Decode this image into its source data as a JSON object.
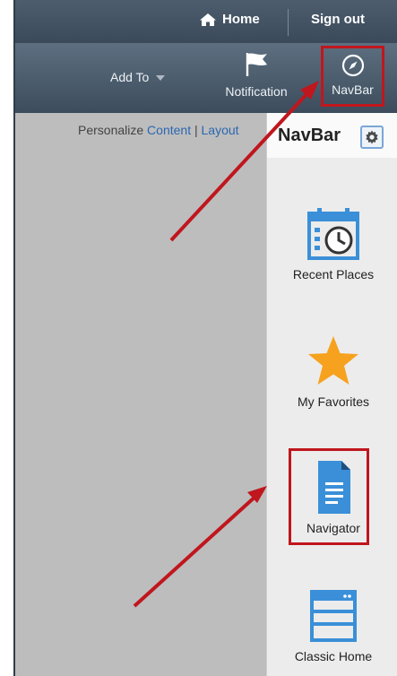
{
  "header": {
    "home_label": "Home",
    "signout_label": "Sign out"
  },
  "actionbar": {
    "addto_label": "Add To",
    "notification_label": "Notification",
    "navbar_label": "NavBar"
  },
  "personalize": {
    "prefix": "Personalize",
    "content_link": "Content",
    "separator": "|",
    "layout_link": "Layout"
  },
  "navbar_panel": {
    "title": "NavBar",
    "tiles": [
      {
        "label": "Recent Places",
        "icon": "calendar-clock-icon"
      },
      {
        "label": "My Favorites",
        "icon": "star-icon"
      },
      {
        "label": "Navigator",
        "icon": "document-icon"
      },
      {
        "label": "Classic Home",
        "icon": "window-icon"
      }
    ]
  },
  "colors": {
    "highlight": "#c0161d",
    "icon_blue": "#3a8fd8",
    "star": "#f6a21e",
    "header": "#3b4a5a"
  }
}
